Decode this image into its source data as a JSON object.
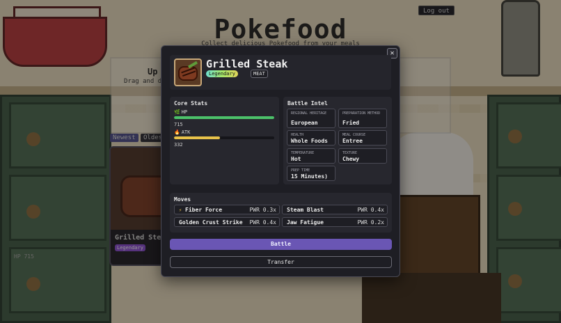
{
  "page": {
    "title": "Pokefood",
    "subtitle": "Collect delicious Pokefood from your meals",
    "logout_label": "Log out",
    "upload_title": "Up",
    "upload_hint": "Drag and d",
    "sort": {
      "newest": "Newest",
      "oldest": "Oldes"
    },
    "card": {
      "name": "Grilled Ste",
      "rarity": "Legendary",
      "hp": "HP 715"
    }
  },
  "modal": {
    "close_label": "✕",
    "food": {
      "name": "Grilled Steak",
      "rarity": "Legendary",
      "type": "MEAT"
    },
    "core_stats": {
      "title": "Core Stats",
      "hp": {
        "icon": "🌿",
        "label": "HP",
        "value": "715",
        "fraction": 1.0,
        "color": "#4cc26a"
      },
      "atk": {
        "icon": "🔥",
        "label": "ATK",
        "value": "332",
        "fraction": 0.46,
        "color": "#e8c24a"
      }
    },
    "battle_intel": {
      "title": "Battle Intel",
      "regional_heritage": {
        "label": "REGIONAL HERITAGE",
        "value": "European"
      },
      "preparation_method": {
        "label": "PREPARATION METHOD",
        "value": "Fried"
      },
      "health": {
        "label": "HEALTH",
        "value": "Whole Foods"
      },
      "meal_course": {
        "label": "MEAL COURSE",
        "value": "Entree"
      },
      "temperature": {
        "label": "TEMPERATURE",
        "value": "Hot"
      },
      "texture": {
        "label": "TEXTURE",
        "value": "Chewy"
      },
      "prep_time": {
        "label": "PREP TIME",
        "value": "15 Minutes)"
      }
    },
    "moves": {
      "title": "Moves",
      "list": [
        {
          "name": "Fiber Force",
          "power": "PWR 0.3x",
          "icon": "⚡"
        },
        {
          "name": "Steam Blast",
          "power": "PWR 0.4x",
          "icon": ""
        },
        {
          "name": "Golden Crust Strike",
          "power": "PWR 0.4x",
          "icon": ""
        },
        {
          "name": "Jaw Fatigue",
          "power": "PWR 0.2x",
          "icon": ""
        }
      ]
    },
    "battle_label": "Battle",
    "transfer_label": "Transfer"
  }
}
